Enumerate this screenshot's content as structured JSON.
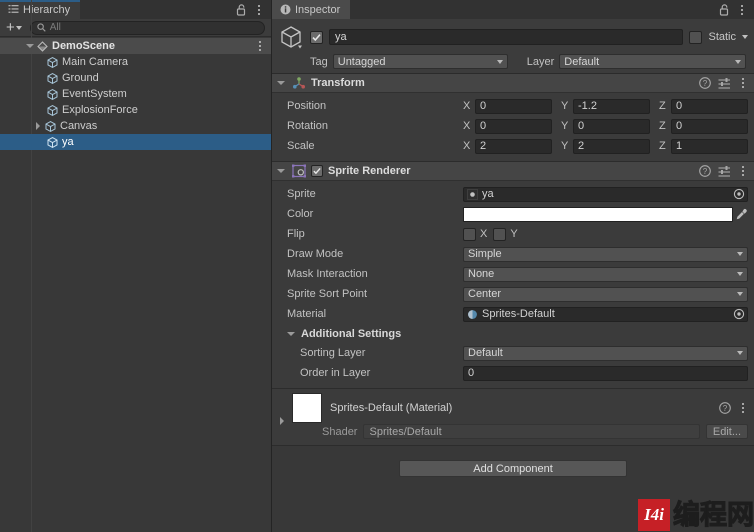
{
  "hierarchy": {
    "tab_label": "Hierarchy",
    "lock_icon": "lock-open-icon",
    "menu_icon": "kebab-menu-icon",
    "add_label": "+",
    "search_placeholder": "All",
    "scene": {
      "name": "DemoScene",
      "expanded": true
    },
    "items": [
      {
        "name": "Main Camera",
        "expandable": false,
        "selected": false
      },
      {
        "name": "Ground",
        "expandable": false,
        "selected": false
      },
      {
        "name": "EventSystem",
        "expandable": false,
        "selected": false
      },
      {
        "name": "ExplosionForce",
        "expandable": false,
        "selected": false
      },
      {
        "name": "Canvas",
        "expandable": true,
        "selected": false
      },
      {
        "name": "ya",
        "expandable": false,
        "selected": true
      }
    ]
  },
  "inspector": {
    "tab_label": "Inspector",
    "lock_icon": "lock-open-icon",
    "menu_icon": "kebab-menu-icon",
    "object": {
      "enabled": true,
      "name": "ya",
      "static_label": "Static",
      "static_checked": false,
      "tag_label": "Tag",
      "tag_value": "Untagged",
      "layer_label": "Layer",
      "layer_value": "Default"
    },
    "transform": {
      "title": "Transform",
      "expanded": true,
      "rows": [
        {
          "label": "Position",
          "x": "0",
          "y": "-1.2",
          "z": "0"
        },
        {
          "label": "Rotation",
          "x": "0",
          "y": "0",
          "z": "0"
        },
        {
          "label": "Scale",
          "x": "2",
          "y": "2",
          "z": "1"
        }
      ],
      "axis_labels": {
        "x": "X",
        "y": "Y",
        "z": "Z"
      }
    },
    "sprite_renderer": {
      "title": "Sprite Renderer",
      "enabled": true,
      "expanded": true,
      "sprite_label": "Sprite",
      "sprite_value": "ya",
      "color_label": "Color",
      "color_value": "#FFFFFF",
      "flip_label": "Flip",
      "flip_x_label": "X",
      "flip_y_label": "Y",
      "flip_x_checked": false,
      "flip_y_checked": false,
      "draw_mode_label": "Draw Mode",
      "draw_mode_value": "Simple",
      "mask_interaction_label": "Mask Interaction",
      "mask_interaction_value": "None",
      "sprite_sort_point_label": "Sprite Sort Point",
      "sprite_sort_point_value": "Center",
      "material_label": "Material",
      "material_value": "Sprites-Default",
      "additional_settings_label": "Additional Settings",
      "sorting_layer_label": "Sorting Layer",
      "sorting_layer_value": "Default",
      "order_in_layer_label": "Order in Layer",
      "order_in_layer_value": "0"
    },
    "material_preview": {
      "title": "Sprites-Default (Material)",
      "shader_label": "Shader",
      "shader_value": "Sprites/Default",
      "edit_label": "Edit...",
      "help_icon": "help-icon",
      "menu_icon": "kebab-menu-icon"
    },
    "add_component_label": "Add Component"
  },
  "watermark": {
    "logo_text": "I4i",
    "text": "编程网",
    "color": "#C62026"
  },
  "colors": {
    "selection_blue": "#2C5D87",
    "panel_bg": "#383838",
    "header_bg": "#454545",
    "field_bg": "#2A2A2A",
    "dropdown_bg": "#515151"
  }
}
